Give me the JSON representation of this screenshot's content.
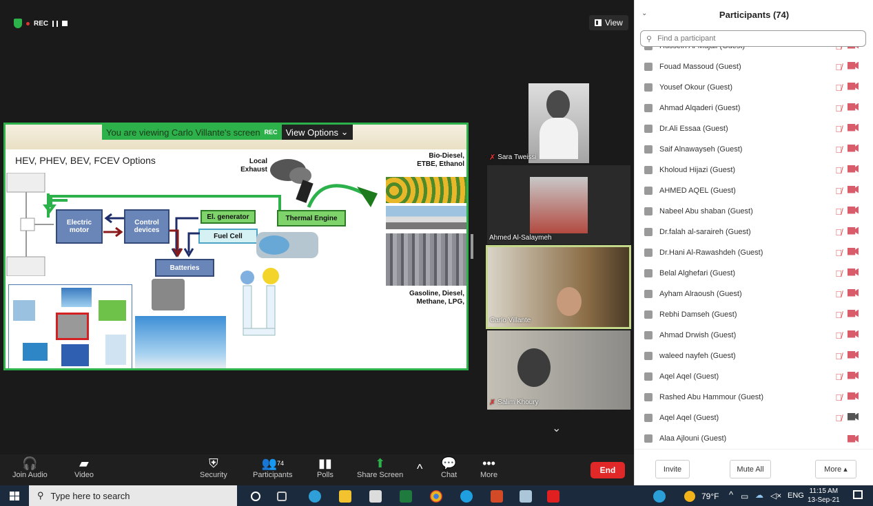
{
  "recording": {
    "label": "REC"
  },
  "view_button": {
    "label": "View"
  },
  "share_banner": {
    "viewing_text": "You are viewing Carlo Villante's screen",
    "rec": "REC",
    "view_options": "View Options"
  },
  "slide": {
    "title": "HEV, PHEV, BEV, FCEV Options",
    "local_exhaust": "Local\nExhaust",
    "bio": "Bio-Diesel,\nETBE, Ethanol",
    "electric_motor": "Electric motor",
    "control_devices": "Control devices",
    "el_generator": "El. generator",
    "thermal_engine": "Thermal Engine",
    "fuel_cell": "Fuel Cell",
    "batteries": "Batteries",
    "fossil": "Gasoline, Diesel,\nMethane, LPG,"
  },
  "videos": [
    {
      "name": "Sara Tweissi",
      "muted": true
    },
    {
      "name": "Ahmed Al-Salaymeh",
      "muted": false
    },
    {
      "name": "Carlo Villante",
      "muted": false
    },
    {
      "name": "Salim Khoury",
      "muted": true
    }
  ],
  "toolbar": {
    "join_audio": "Join Audio",
    "video": "Video",
    "security": "Security",
    "participants": "Participants",
    "participants_count": "74",
    "polls": "Polls",
    "share_screen": "Share Screen",
    "chat": "Chat",
    "more": "More",
    "end": "End"
  },
  "panel": {
    "title": "Participants (74)",
    "search_placeholder": "Find a participant",
    "participants": [
      {
        "name": "Hussein Al-Mujali (Guest)",
        "cam": "muted"
      },
      {
        "name": "Fouad Massoud (Guest)",
        "cam": "muted"
      },
      {
        "name": "Yousef Okour (Guest)",
        "cam": "muted"
      },
      {
        "name": "Ahmad Alqaderi (Guest)",
        "cam": "muted"
      },
      {
        "name": "Dr.Ali Essaa (Guest)",
        "cam": "muted"
      },
      {
        "name": "Saif Alnawayseh (Guest)",
        "cam": "muted"
      },
      {
        "name": "Kholoud Hijazi (Guest)",
        "cam": "muted"
      },
      {
        "name": "AHMED AQEL (Guest)",
        "cam": "muted"
      },
      {
        "name": "Nabeel Abu shaban (Guest)",
        "cam": "muted"
      },
      {
        "name": "Dr.falah al-saraireh (Guest)",
        "cam": "muted"
      },
      {
        "name": "Dr.Hani Al-Rawashdeh (Guest)",
        "cam": "muted"
      },
      {
        "name": "Belal Alghefari (Guest)",
        "cam": "muted"
      },
      {
        "name": "Ayham Alraoush (Guest)",
        "cam": "muted"
      },
      {
        "name": "Rebhi Damseh (Guest)",
        "cam": "muted"
      },
      {
        "name": "Ahmad Drwish (Guest)",
        "cam": "muted"
      },
      {
        "name": "waleed nayfeh (Guest)",
        "cam": "muted"
      },
      {
        "name": "Aqel Aqel (Guest)",
        "cam": "muted"
      },
      {
        "name": "Rashed Abu Hammour (Guest)",
        "cam": "muted"
      },
      {
        "name": "Aqel Aqel (Guest)",
        "cam": "on"
      },
      {
        "name": "Alaa Ajlouni (Guest)",
        "cam": "muted-only"
      }
    ],
    "invite": "Invite",
    "mute_all": "Mute All",
    "more": "More"
  },
  "taskbar": {
    "search_placeholder": "Type here to search",
    "weather": "79°F",
    "lang": "ENG",
    "time": "11:15 AM",
    "date": "13-Sep-21"
  }
}
